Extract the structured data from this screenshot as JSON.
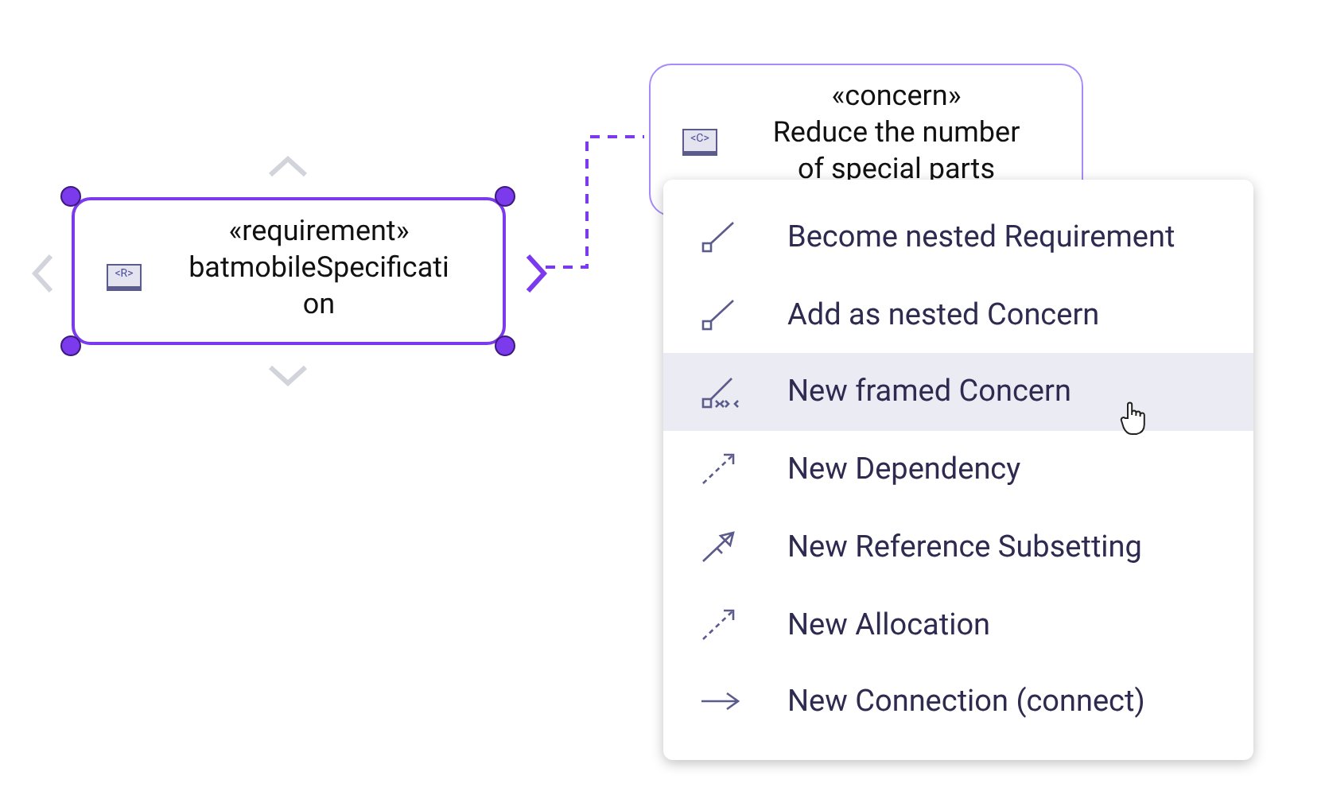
{
  "nodes": [
    {
      "stereotype": "«requirement»",
      "name_lines": [
        "batmobileSpecificati",
        "on"
      ],
      "selected": true,
      "icon_label": "<R>"
    },
    {
      "stereotype": "«concern»",
      "name_lines": [
        "Reduce the number",
        "of special parts"
      ],
      "selected": false,
      "icon_label": "<C>"
    }
  ],
  "context_menu": {
    "items": [
      {
        "kind": "nest",
        "label": "Become nested Requirement",
        "selected": false
      },
      {
        "kind": "nest",
        "label": "Add as nested Concern",
        "selected": false
      },
      {
        "kind": "frame",
        "label": "New framed Concern",
        "selected": true
      },
      {
        "kind": "dashed",
        "label": "New Dependency",
        "selected": false
      },
      {
        "kind": "subset",
        "label": "New Reference Subsetting",
        "selected": false
      },
      {
        "kind": "dashed",
        "label": "New Allocation",
        "selected": false
      },
      {
        "kind": "arrow",
        "label": "New Connection (connect)",
        "selected": false
      }
    ]
  }
}
